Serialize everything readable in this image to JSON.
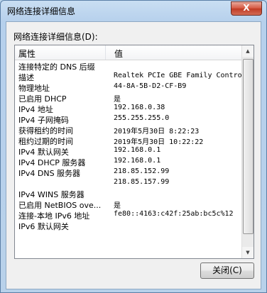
{
  "window": {
    "title": "网络连接详细信息",
    "close_glyph": "X"
  },
  "group_label": "网络连接详细信息(D):",
  "columns": [
    "属性",
    "值"
  ],
  "rows": [
    {
      "prop": "连接特定的 DNS 后缀",
      "value": ""
    },
    {
      "prop": "描述",
      "value": "Realtek PCIe GBE Family Contro"
    },
    {
      "prop": "物理地址",
      "value": "44-8A-5B-D2-CF-B9"
    },
    {
      "prop": "已启用 DHCP",
      "value": "是"
    },
    {
      "prop": "IPv4 地址",
      "value": "192.168.0.38"
    },
    {
      "prop": "IPv4 子网掩码",
      "value": "255.255.255.0"
    },
    {
      "prop": "获得租约的时间",
      "value": "2019年5月30日 8:22:23"
    },
    {
      "prop": "租约过期的时间",
      "value": "2019年5月30日 10:22:22"
    },
    {
      "prop": "IPv4 默认网关",
      "value": "192.168.0.1"
    },
    {
      "prop": "IPv4 DHCP 服务器",
      "value": "192.168.0.1"
    },
    {
      "prop": "IPv4 DNS 服务器",
      "value": "218.85.152.99"
    },
    {
      "prop": "",
      "value": "218.85.157.99"
    },
    {
      "prop": "IPv4 WINS 服务器",
      "value": ""
    },
    {
      "prop": "已启用 NetBIOS ove...",
      "value": "是"
    },
    {
      "prop": "连接-本地 IPv6 地址",
      "value": "fe80::4163:c42f:25ab:bc5c%12"
    },
    {
      "prop": "IPv6 默认网关",
      "value": ""
    }
  ],
  "close_button_label": "关闭(C)"
}
